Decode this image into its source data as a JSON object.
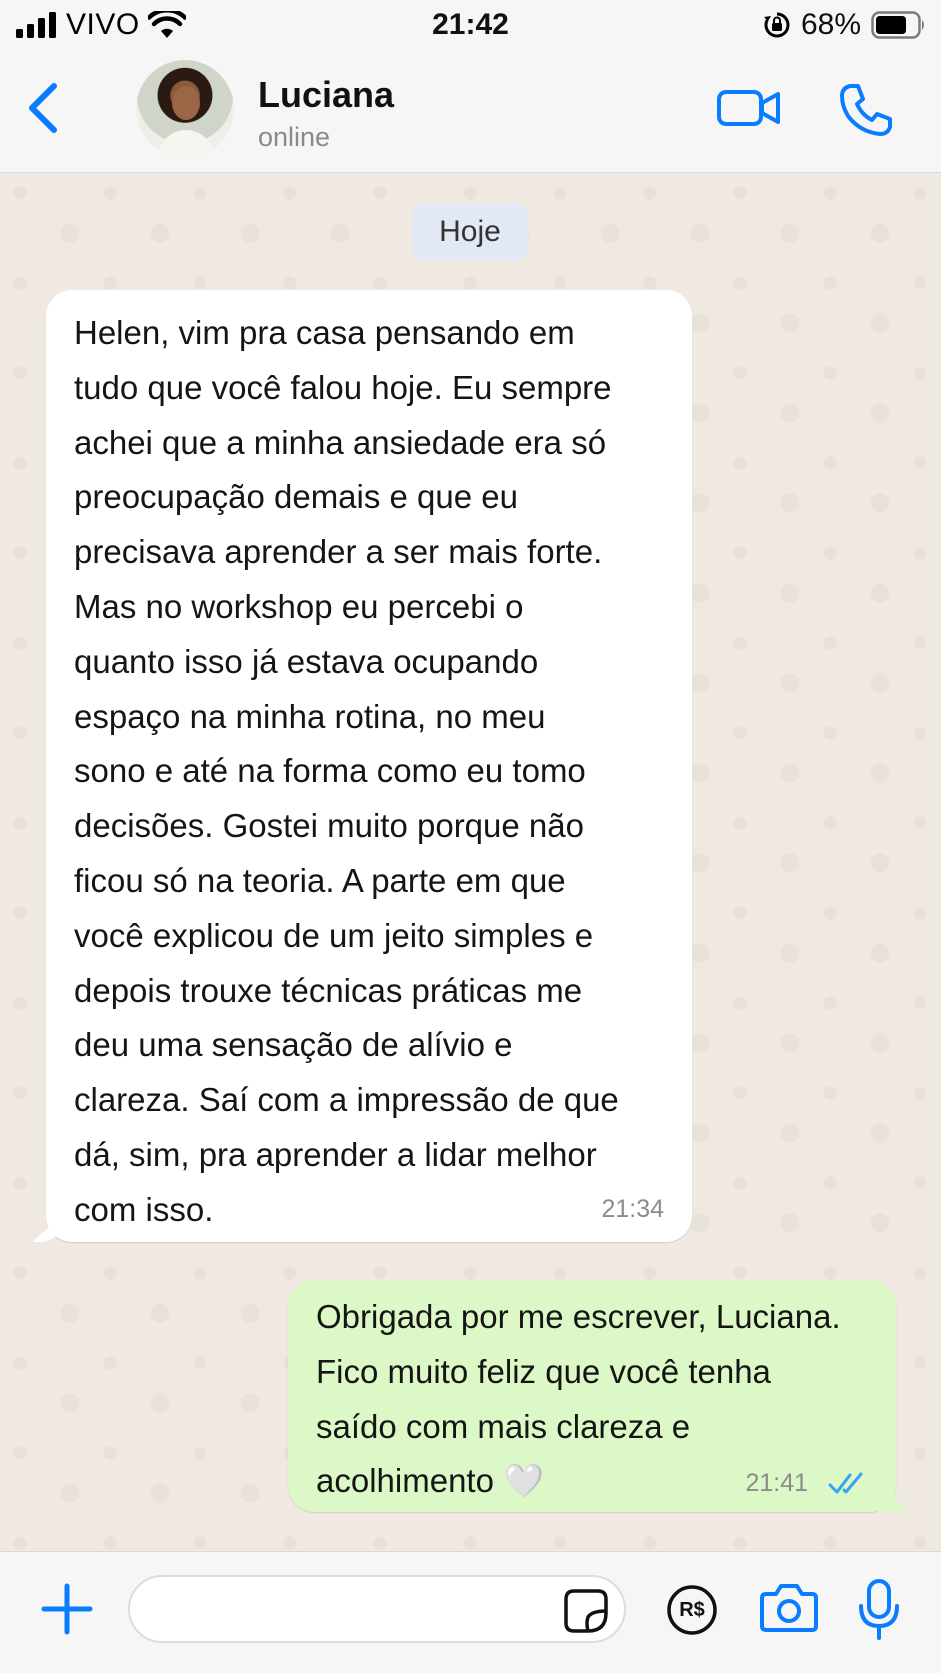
{
  "status_bar": {
    "carrier": "VIVO",
    "time": "21:42",
    "battery": "68%",
    "icons": [
      "signal-icon",
      "wifi-icon",
      "orientation-lock-icon",
      "battery-icon"
    ]
  },
  "header": {
    "contact_name": "Luciana",
    "contact_status": "online",
    "icons": [
      "back-icon",
      "avatar",
      "video-call-icon",
      "voice-call-icon"
    ]
  },
  "chat": {
    "date_label": "Hoje",
    "messages": [
      {
        "direction": "incoming",
        "text": "Helen, vim pra casa pensando em\ntudo que você falou hoje. Eu sempre\nachei que a minha ansiedade era só\npreocupação demais e que eu\nprecisava aprender a ser mais forte.\nMas no workshop eu percebi o\nquanto isso já estava ocupando\nespaço na minha rotina, no meu\nsono e até na forma como eu tomo\ndecisões. Gostei muito porque não\nficou só na teoria. A parte em que\nvocê explicou de um jeito simples e\ndepois trouxe técnicas práticas me\ndeu uma sensação de alívio e\nclareza. Saí com a impressão de que\ndá, sim, pra aprender a lidar melhor\ncom isso.",
        "time": "21:34"
      },
      {
        "direction": "outgoing",
        "text": "Obrigada por me escrever, Luciana.\nFico muito feliz que você tenha\nsaído com mais clareza e\nacolhimento 🤍",
        "time": "21:41",
        "status": "read"
      }
    ]
  },
  "composer": {
    "input_value": "",
    "icons": [
      "plus-icon",
      "sticker-icon",
      "pix-icon",
      "camera-icon",
      "microphone-icon"
    ],
    "pix_label": "R$"
  },
  "colors": {
    "accent": "#0a7cff",
    "incoming_bubble": "#ffffff",
    "outgoing_bubble": "#dcf8c6",
    "chat_background": "#efe9e1",
    "bar_background": "#f6f6f6",
    "read_ticks": "#34a4f2"
  }
}
